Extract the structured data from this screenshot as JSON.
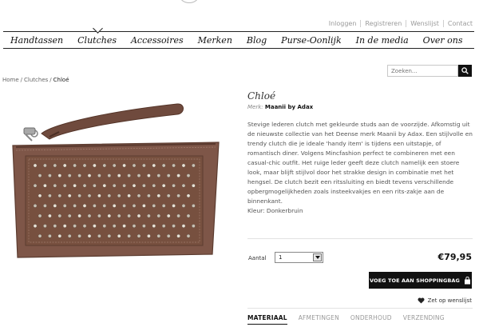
{
  "utility_links": [
    "Inloggen",
    "Registreren",
    "Wenslijst",
    "Contact"
  ],
  "nav": {
    "items": [
      "Handtassen",
      "Clutches",
      "Accessoires",
      "Merken",
      "Blog",
      "Purse-Oonlijk",
      "In de media",
      "Over ons"
    ],
    "active_index": 1
  },
  "search": {
    "placeholder": "Zoeken..."
  },
  "breadcrumb": [
    "Home",
    "Clutches",
    "Chloé"
  ],
  "product": {
    "title": "Chloé",
    "brand_label": "Merk:",
    "brand": "Maanii by Adax",
    "description": "Stevige lederen clutch met gekleurde studs aan de voorzijde. Afkomstig uit de nieuwste collectie van het Deense merk Maanii by Adax. Een stijlvolle en trendy clutch die je ideale 'handy item' is tijdens een uitstapje, of romantisch diner. Volgens Mincfashion perfect te combineren met een casual-chic outfit. Het ruige leder geeft deze clutch namelijk een stoere look, maar blijft stijlvol door het strakke design in combinatie met het hengsel. De clutch bezit een ritssluiting en biedt tevens verschillende opbergmogelijkheden zoals insteekvakjes en een rits-zakje aan de binnenkant.",
    "color_line": "Kleur: Donkerbruin",
    "qty_label": "Aantal",
    "qty_value": "1",
    "price": "€79,95",
    "cart_button": "VOEG TOE AAN SHOPPINGBAG",
    "wishlist_label": "Zet op wenslijst"
  },
  "tabs": [
    "MATERIAAL",
    "AFMETINGEN",
    "ONDERHOUD",
    "VERZENDING"
  ],
  "colors": {
    "leather": "#7e5648",
    "accent": "#111111"
  }
}
